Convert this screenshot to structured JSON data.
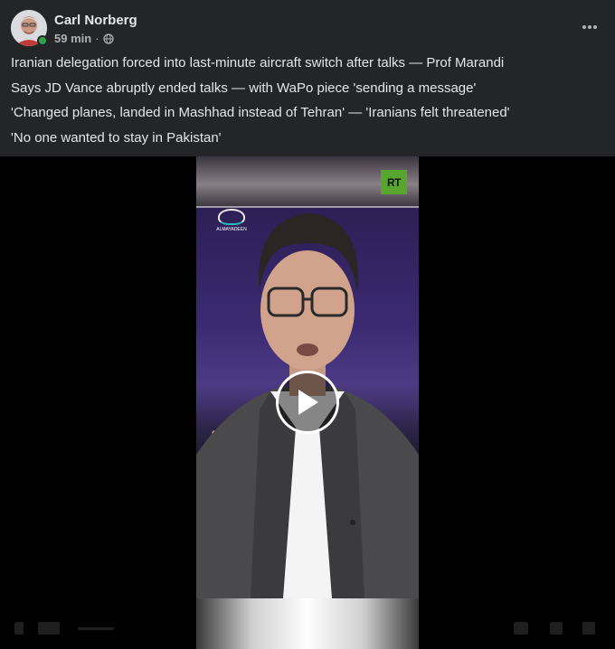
{
  "post": {
    "author": "Carl Norberg",
    "time": "59 min",
    "separator": "·",
    "visibility_icon": "globe-icon",
    "more_icon": "more-dots-icon",
    "lines": [
      "Iranian delegation forced into last-minute aircraft switch after talks — Prof Marandi",
      "Says JD Vance abruptly ended talks — with WaPo piece 'sending a message'",
      "'Changed planes, landed in Mashhad instead of Tehran' — 'Iranians felt threatened'",
      "'No one wanted to stay in Pakistan'"
    ]
  },
  "video": {
    "rt_logo": "RT",
    "channel_logo": "ALMAYADEEN",
    "play_icon": "play-icon"
  },
  "colors": {
    "background": "#242526",
    "text": "#e4e6eb",
    "secondary_text": "#b0b3b8",
    "online": "#31a24c",
    "rt_green": "#58a52f"
  }
}
